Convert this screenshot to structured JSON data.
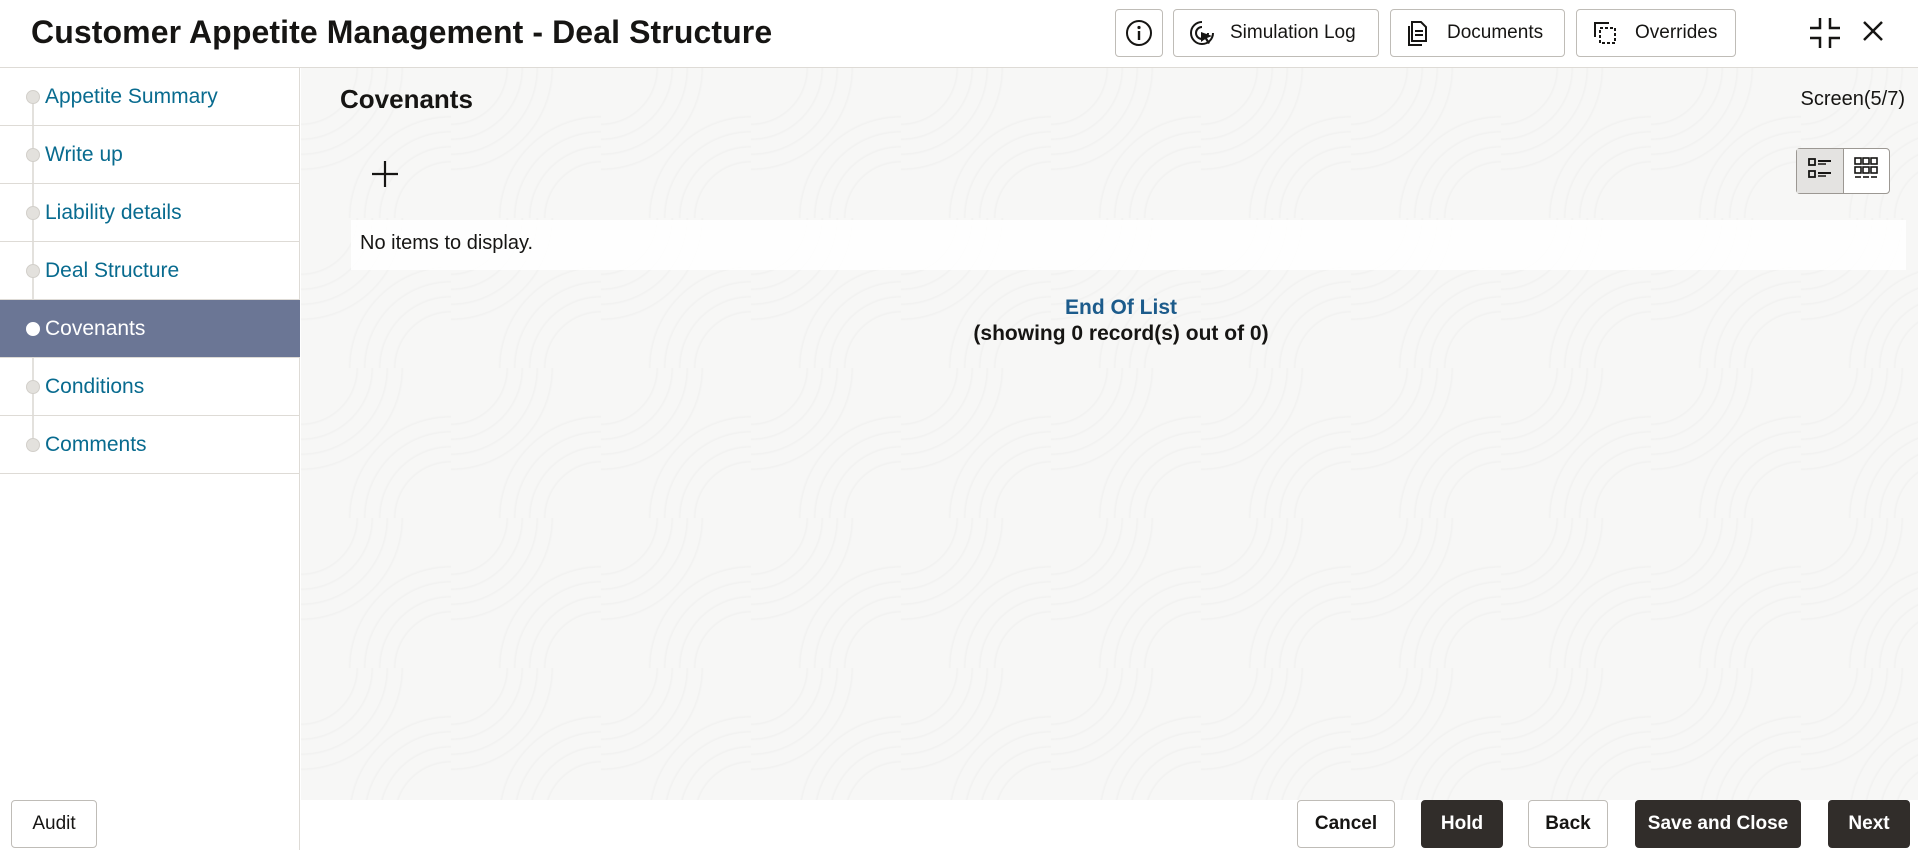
{
  "header": {
    "title": "Customer Appetite Management - Deal Structure",
    "buttons": {
      "info_icon": "info-icon",
      "simulation_log": "Simulation Log",
      "documents": "Documents",
      "overrides": "Overrides"
    }
  },
  "sidebar": {
    "items": [
      {
        "label": "Appetite Summary",
        "active": false
      },
      {
        "label": "Write up",
        "active": false
      },
      {
        "label": "Liability details",
        "active": false
      },
      {
        "label": "Deal Structure",
        "active": false
      },
      {
        "label": "Covenants",
        "active": true
      },
      {
        "label": "Conditions",
        "active": false
      },
      {
        "label": "Comments",
        "active": false
      }
    ]
  },
  "main": {
    "section_title": "Covenants",
    "screen_indicator": "Screen(5/7)",
    "empty_message": "No items to display.",
    "end_of_list": "End Of List",
    "record_count": "(showing 0 record(s) out of 0)"
  },
  "footer": {
    "audit": "Audit",
    "cancel": "Cancel",
    "hold": "Hold",
    "back": "Back",
    "save_and_close": "Save and Close",
    "next": "Next"
  },
  "colors": {
    "nav_link": "#086b8f",
    "nav_active_bg": "#6b7695",
    "dark_button": "#312d2a",
    "end_of_list": "#1c5b8b"
  }
}
